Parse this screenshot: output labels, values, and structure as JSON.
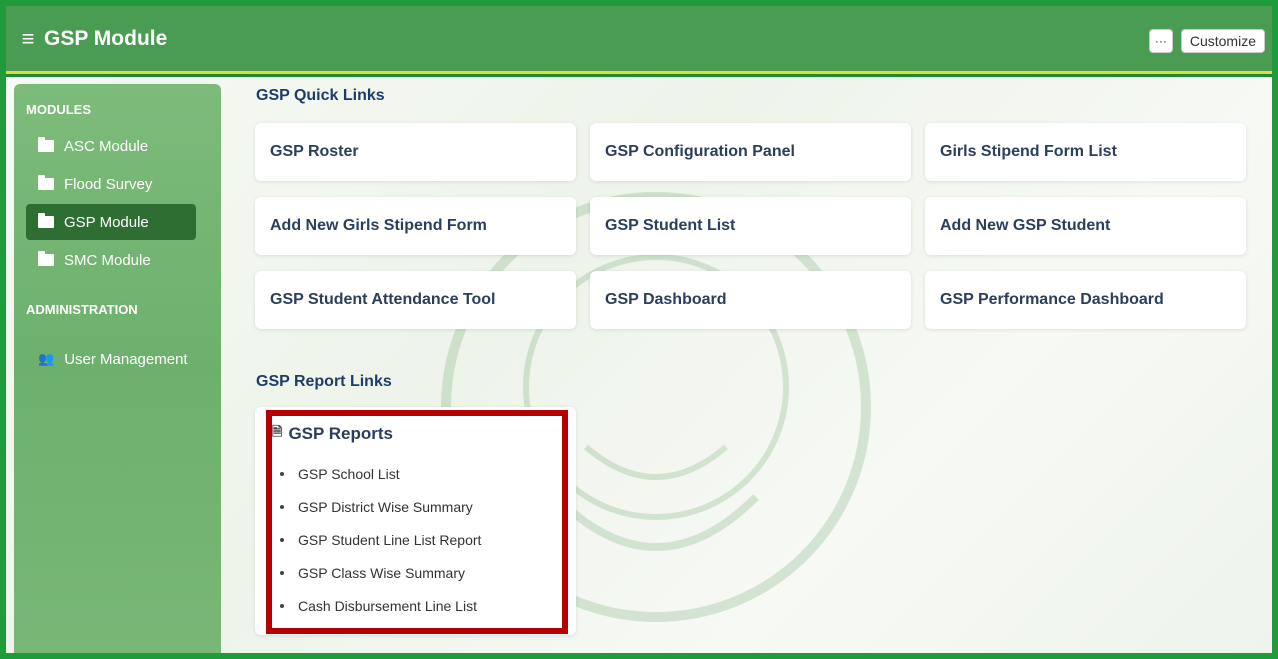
{
  "header": {
    "title": "GSP Module",
    "dots": "···",
    "customize": "Customize"
  },
  "sidebar": {
    "modules_header": "MODULES",
    "modules": [
      {
        "label": "ASC Module"
      },
      {
        "label": "Flood Survey"
      },
      {
        "label": "GSP Module"
      },
      {
        "label": "SMC Module"
      }
    ],
    "admin_header": "ADMINISTRATION",
    "admin_items": [
      {
        "label": "User Management"
      }
    ]
  },
  "quick_links": {
    "title": "GSP Quick Links",
    "items": [
      "GSP Roster",
      "GSP Configuration Panel",
      "Girls Stipend Form List",
      "Add New Girls Stipend Form",
      "GSP Student List",
      "Add New GSP Student",
      "GSP Student Attendance Tool",
      "GSP Dashboard",
      "GSP Performance Dashboard"
    ]
  },
  "report_links": {
    "title": "GSP Report Links",
    "card_title": "GSP Reports",
    "items": [
      "GSP School List",
      "GSP District Wise Summary",
      "GSP Student Line List Report",
      "GSP Class Wise Summary",
      "Cash Disbursement Line List"
    ]
  }
}
